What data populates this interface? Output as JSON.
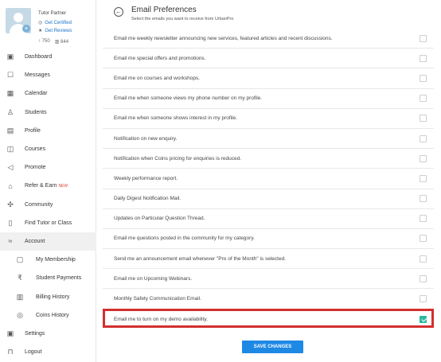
{
  "profile": {
    "role": "Tutor Partner",
    "get_certified": "Get Certified",
    "get_reviews": "Get Reviews",
    "stat_up": "750",
    "stat_views": "844"
  },
  "nav": [
    {
      "label": "Dashboard",
      "icon": "dashboard-icon",
      "glyph": "▣"
    },
    {
      "label": "Messages",
      "icon": "messages-icon",
      "glyph": "☐"
    },
    {
      "label": "Calendar",
      "icon": "calendar-icon",
      "glyph": "▦"
    },
    {
      "label": "Students",
      "icon": "students-icon",
      "glyph": "♙"
    },
    {
      "label": "Profile",
      "icon": "profile-icon",
      "glyph": "▤"
    },
    {
      "label": "Courses",
      "icon": "courses-icon",
      "glyph": "◫"
    },
    {
      "label": "Promote",
      "icon": "promote-icon",
      "glyph": "◁"
    },
    {
      "label": "Refer & Earn",
      "icon": "refer-icon",
      "glyph": "⌂",
      "badge": "NEW"
    },
    {
      "label": "Community",
      "icon": "community-icon",
      "glyph": "✣"
    },
    {
      "label": "Find Tutor or Class",
      "icon": "find-icon",
      "glyph": "▯"
    },
    {
      "label": "Account",
      "icon": "account-icon",
      "glyph": "≈"
    },
    {
      "label": "My Membership",
      "icon": "membership-icon",
      "glyph": "▢",
      "sub": true
    },
    {
      "label": "Student Payments",
      "icon": "rupee-icon",
      "glyph": "₹",
      "sub": true
    },
    {
      "label": "Billing History",
      "icon": "billing-icon",
      "glyph": "▥",
      "sub": true
    },
    {
      "label": "Coins History",
      "icon": "coins-icon",
      "glyph": "◎",
      "sub": true
    },
    {
      "label": "Settings",
      "icon": "settings-icon",
      "glyph": "▣"
    },
    {
      "label": "Logout",
      "icon": "logout-icon",
      "glyph": "⊓"
    }
  ],
  "header": {
    "title": "Email Preferences",
    "subtitle": "Select the emails you want to receive from UrbanPro"
  },
  "preferences": [
    {
      "label": "Email me weekly newsletter announcing new services, featured articles and recent discussions.",
      "checked": false
    },
    {
      "label": "Email me special offers and promotions.",
      "checked": false
    },
    {
      "label": "Email me on courses and workshops.",
      "checked": false
    },
    {
      "label": "Email me when someone views my phone number on my profile.",
      "checked": false
    },
    {
      "label": "Email me when someone shows interest in my profile.",
      "checked": false
    },
    {
      "label": "Notification on new enquiry.",
      "checked": false
    },
    {
      "label": "Notification when Coins pricing for enquiries is reduced.",
      "checked": false
    },
    {
      "label": "Weekly performance report.",
      "checked": false
    },
    {
      "label": "Daily Digest Notification Mail.",
      "checked": false
    },
    {
      "label": "Updates on Particular Question Thread.",
      "checked": false
    },
    {
      "label": "Email me questions posted in the community for my category.",
      "checked": false
    },
    {
      "label": "Send me an announcement email whenever \"Pro of the Month\" is selected.",
      "checked": false
    },
    {
      "label": "Email me on Upcoming Webinars.",
      "checked": false
    },
    {
      "label": "Monthly Safety Communication Email.",
      "checked": false
    },
    {
      "label": "Email me to turn on my demo availability.",
      "checked": true
    }
  ],
  "save_label": "SAVE CHANGES",
  "colors": {
    "accent": "#1e88e5",
    "checked": "#2db89e",
    "highlight": "#d32f2f",
    "link": "#1a73c8"
  }
}
